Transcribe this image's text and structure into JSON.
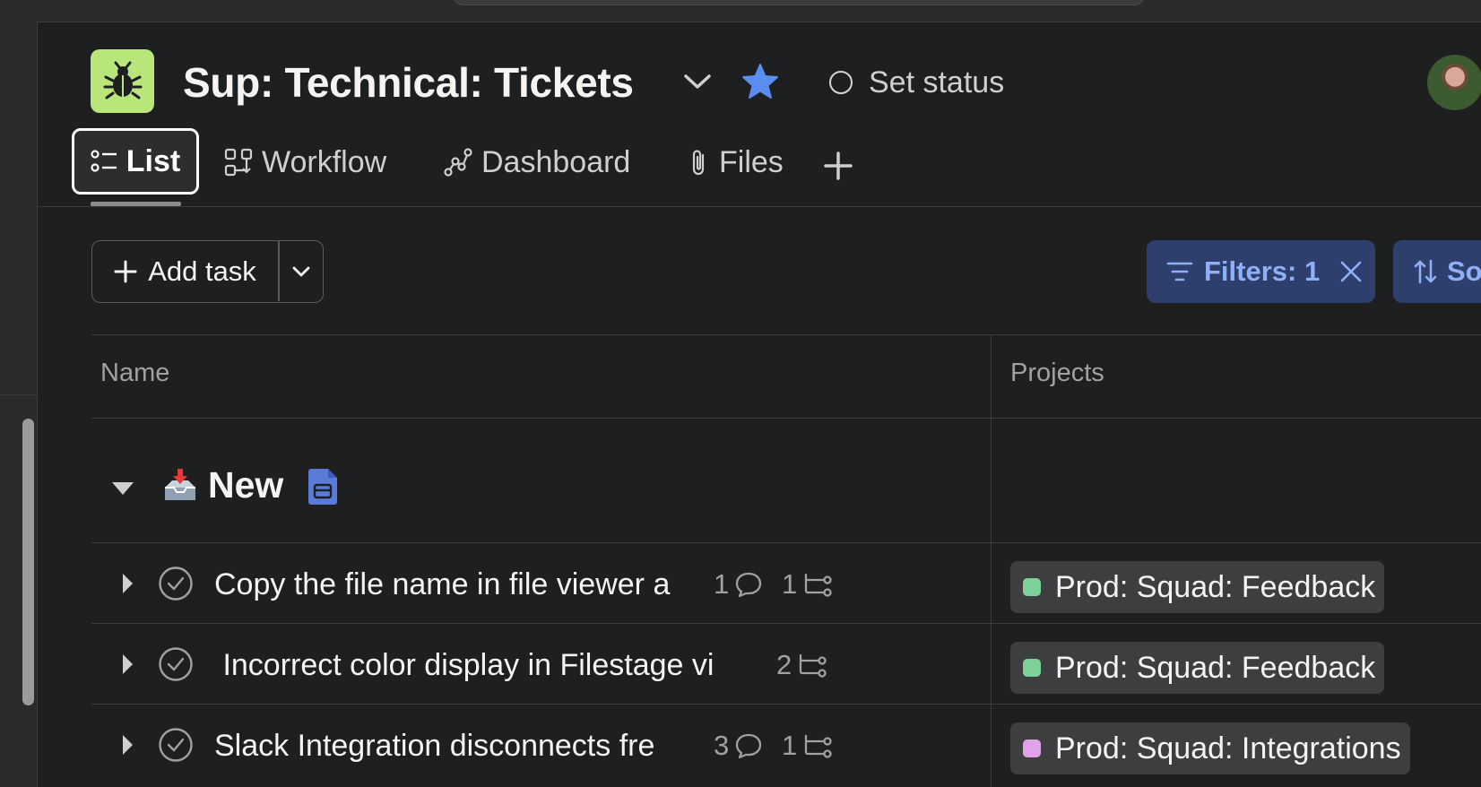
{
  "header": {
    "project_title": "Sup: Technical: Tickets",
    "set_status_label": "Set status",
    "project_icon_color": "#b9e67a",
    "star_color": "#5b8def"
  },
  "tabs": [
    {
      "label": "List",
      "icon": "list-icon",
      "active": true
    },
    {
      "label": "Workflow",
      "icon": "workflow-icon"
    },
    {
      "label": "Dashboard",
      "icon": "dashboard-icon"
    },
    {
      "label": "Files",
      "icon": "paperclip-icon"
    }
  ],
  "toolbar": {
    "add_task_label": "Add task",
    "filters_label": "Filters: 1",
    "sort_label": "So"
  },
  "table": {
    "columns": [
      "Name",
      "Projects"
    ],
    "section": {
      "title": "New",
      "emoji": "inbox-tray-icon"
    },
    "rows": [
      {
        "name": "Copy the file name in file viewer a",
        "comments": "1",
        "subtasks": "1",
        "project": "Prod: Squad: Feedback",
        "project_color": "#7fd19a"
      },
      {
        "name": " Incorrect color display in Filestage vi",
        "comments": "",
        "subtasks": "2",
        "project": "Prod: Squad: Feedback",
        "project_color": "#7fd19a"
      },
      {
        "name": "Slack Integration disconnects fre",
        "comments": "3",
        "subtasks": "1",
        "project": "Prod: Squad: Integrations",
        "project_color": "#e0a3e8"
      }
    ]
  }
}
